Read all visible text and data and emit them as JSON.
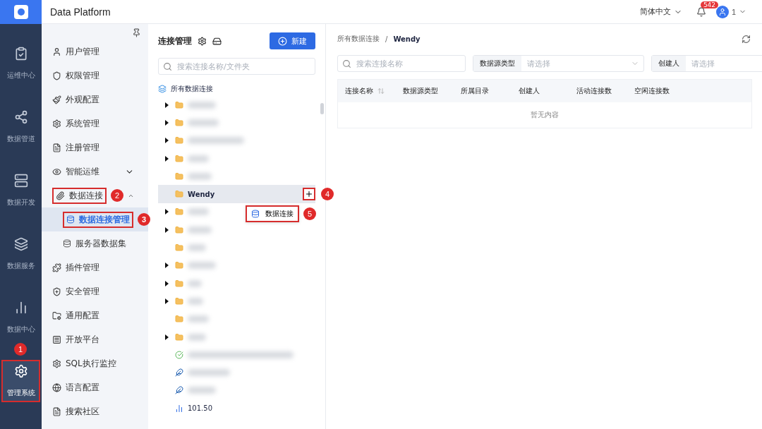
{
  "header": {
    "title": "Data Platform",
    "language": "简体中文",
    "notification_count": "542",
    "user": "1"
  },
  "rail": [
    {
      "label": "运维中心",
      "selected": false
    },
    {
      "label": "数据管道",
      "selected": false
    },
    {
      "label": "数据开发",
      "selected": false
    },
    {
      "label": "数据服务",
      "selected": false
    },
    {
      "label": "数据中心",
      "selected": false
    },
    {
      "label": "管理系统",
      "selected": true,
      "annotation": "1"
    }
  ],
  "menu": [
    {
      "label": "用户管理"
    },
    {
      "label": "权限管理"
    },
    {
      "label": "外观配置"
    },
    {
      "label": "系统管理"
    },
    {
      "label": "注册管理"
    },
    {
      "label": "智能运维",
      "expanded": false
    },
    {
      "label": "数据连接",
      "expanded": true,
      "annotation": "2",
      "children": [
        {
          "label": "数据连接管理",
          "selected": true,
          "annotation": "3"
        },
        {
          "label": "服务器数据集",
          "selected": false
        }
      ]
    },
    {
      "label": "插件管理"
    },
    {
      "label": "安全管理"
    },
    {
      "label": "通用配置"
    },
    {
      "label": "开放平台"
    },
    {
      "label": "SQL执行监控"
    },
    {
      "label": "语言配置"
    },
    {
      "label": "搜索社区"
    }
  ],
  "tree_panel": {
    "title": "连接管理",
    "new_button": "新建",
    "search": {
      "placeholder": "搜索连接名称/文件夹"
    },
    "root": "所有数据连接",
    "items": [
      {
        "kind": "folder",
        "expandable": true
      },
      {
        "kind": "folder",
        "expandable": true
      },
      {
        "kind": "folder",
        "expandable": true
      },
      {
        "kind": "folder",
        "expandable": true
      },
      {
        "kind": "folder",
        "expandable": false
      },
      {
        "kind": "folder",
        "expandable": false,
        "label": "Wendy",
        "selected": true,
        "annotation": "4",
        "menu": {
          "label": "数据连接",
          "annotation": "5"
        }
      },
      {
        "kind": "folder",
        "expandable": true
      },
      {
        "kind": "folder",
        "expandable": true
      },
      {
        "kind": "folder",
        "expandable": false
      },
      {
        "kind": "folder",
        "expandable": true
      },
      {
        "kind": "folder",
        "expandable": true
      },
      {
        "kind": "folder",
        "expandable": true
      },
      {
        "kind": "folder",
        "expandable": false
      },
      {
        "kind": "folder",
        "expandable": true
      },
      {
        "kind": "check",
        "expandable": false
      },
      {
        "kind": "feather",
        "expandable": false
      },
      {
        "kind": "feather",
        "expandable": false
      },
      {
        "kind": "chart",
        "expandable": false,
        "label": "101.50"
      }
    ]
  },
  "main": {
    "breadcrumb": {
      "items": [
        "所有数据连接",
        "Wendy"
      ],
      "separator": "/"
    },
    "search": {
      "placeholder": "搜索连接名称"
    },
    "filters": [
      {
        "label": "数据源类型",
        "placeholder": "请选择"
      },
      {
        "label": "创建人",
        "placeholder": "请选择"
      }
    ],
    "table": {
      "columns": [
        "连接名称",
        "数据源类型",
        "所属目录",
        "创建人",
        "活动连接数",
        "空闲连接数"
      ],
      "empty": "暂无内容"
    }
  }
}
